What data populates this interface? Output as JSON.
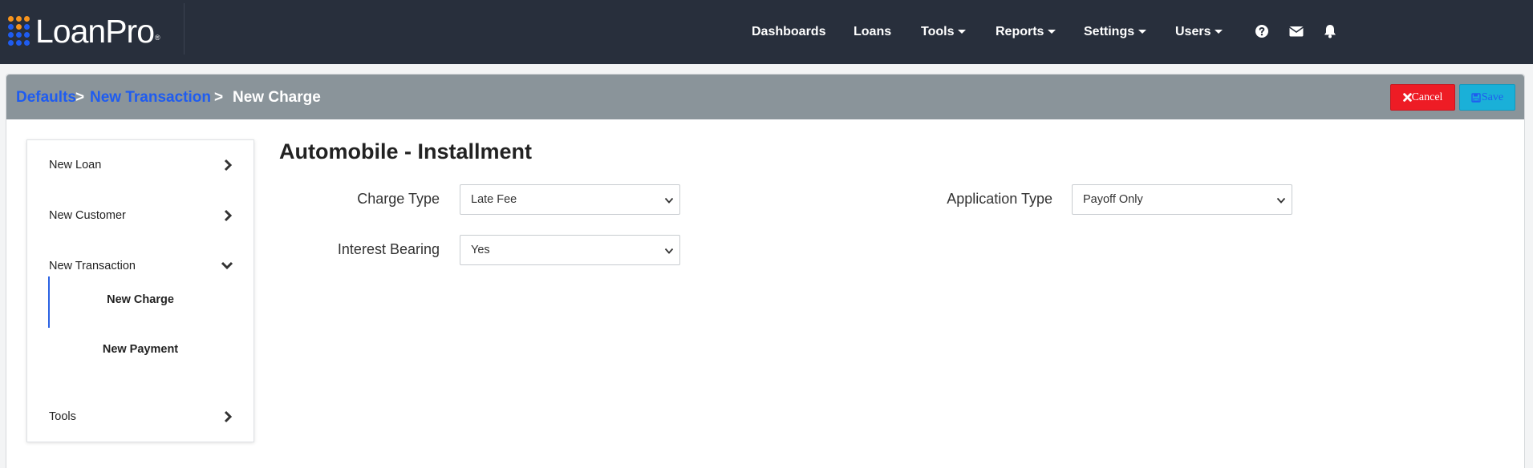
{
  "app": {
    "logo_text": "LoanPro",
    "logo_mark": "®",
    "logo_dot_colors": [
      "#f7941d",
      "#f7941d",
      "#f7941d",
      "#1f5cf0",
      "#f7941d",
      "#1f5cf0",
      "#1f5cf0",
      "#1f5cf0",
      "#1f5cf0",
      "#1f5cf0",
      "#1f5cf0",
      "#1f5cf0"
    ]
  },
  "nav": {
    "dashboards": "Dashboards",
    "loans": "Loans",
    "tools": "Tools",
    "reports": "Reports",
    "settings": "Settings",
    "users": "Users",
    "icons": [
      "help-icon",
      "mail-icon",
      "bell-icon"
    ]
  },
  "breadcrumb": {
    "items": [
      "Defaults",
      "New Transaction",
      "New Charge"
    ],
    "separator": ">"
  },
  "actions": {
    "cancel": "Cancel",
    "save": "Save"
  },
  "sidebar": {
    "items": [
      {
        "label": "New Loan",
        "state": "collapsed"
      },
      {
        "label": "New Customer",
        "state": "collapsed"
      },
      {
        "label": "New Transaction",
        "state": "expanded"
      },
      {
        "label": "Tools",
        "state": "collapsed"
      }
    ],
    "subitems": [
      "New Charge",
      "New Payment"
    ],
    "active_subitem": "New Charge"
  },
  "form": {
    "title": "Automobile - Installment",
    "charge_type": {
      "label": "Charge Type",
      "value": "Late Fee"
    },
    "interest_bearing": {
      "label": "Interest Bearing",
      "value": "Yes"
    },
    "application_type": {
      "label": "Application Type",
      "value": "Payoff Only"
    }
  },
  "colors": {
    "topbar": "#282f3c",
    "panel_header": "#8a949a",
    "link": "#1f5cf0",
    "cancel": "#ee1c25",
    "save": "#1ab0d8",
    "active_indicator": "#2a62e3"
  }
}
